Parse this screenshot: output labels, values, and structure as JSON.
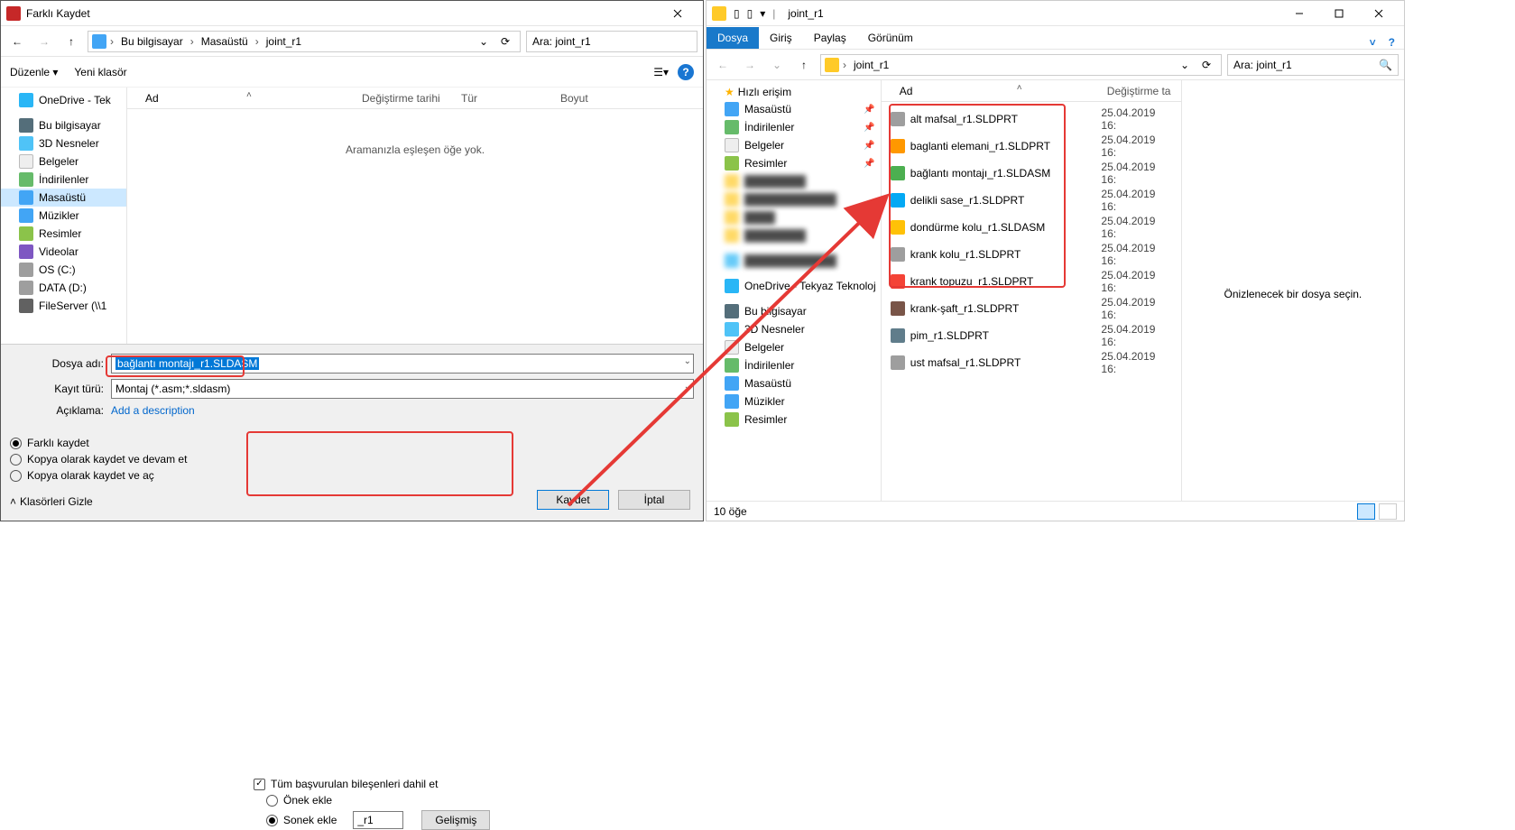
{
  "left": {
    "title": "Farklı Kaydet",
    "nav": {
      "pc": "Bu bilgisayar",
      "desk": "Masaüstü",
      "folder": "joint_r1"
    },
    "search_ph": "Ara: joint_r1",
    "toolbar": {
      "organize": "Düzenle",
      "newfolder": "Yeni klasör"
    },
    "cols": {
      "name": "Ad",
      "date": "Değiştirme tarihi",
      "type": "Tür",
      "size": "Boyut"
    },
    "empty": "Aramanızla eşleşen öğe yok.",
    "tree": {
      "onedrive": "OneDrive - Tek",
      "pc": "Bu bilgisayar",
      "objects3d": "3D Nesneler",
      "docs": "Belgeler",
      "downloads": "İndirilenler",
      "desktop": "Masaüstü",
      "music": "Müzikler",
      "pictures": "Resimler",
      "videos": "Videolar",
      "osc": "OS (C:)",
      "data": "DATA (D:)",
      "fileserver": "FileServer (\\\\1"
    },
    "lbl_filename": "Dosya adı:",
    "filename": "bağlantı montajı_r1.SLDASM",
    "lbl_filetype": "Kayıt türü:",
    "filetype": "Montaj (*.asm;*.sldasm)",
    "lbl_desc": "Açıklama:",
    "desc_link": "Add a description",
    "opt_saveas": "Farklı kaydet",
    "opt_savecopycontinue": "Kopya olarak kaydet ve devam et",
    "opt_savecopyopen": "Kopya olarak kaydet ve aç",
    "chk_includeall": "Tüm başvurulan bileşenleri dahil et",
    "opt_prefix": "Önek ekle",
    "opt_suffix": "Sonek ekle",
    "suffix_val": "_r1",
    "btn_advanced": "Gelişmiş",
    "btn_save": "Kaydet",
    "btn_cancel": "İptal",
    "hide_folders": "Klasörleri Gizle"
  },
  "right": {
    "title": "joint_r1",
    "tabs": {
      "file": "Dosya",
      "home": "Giriş",
      "share": "Paylaş",
      "view": "Görünüm"
    },
    "search_ph": "Ara: joint_r1",
    "addr_folder": "joint_r1",
    "cols": {
      "name": "Ad",
      "date": "Değiştirme ta"
    },
    "tree": {
      "quick": "Hızlı erişim",
      "desktop": "Masaüstü",
      "downloads": "İndirilenler",
      "docs": "Belgeler",
      "pictures": "Resimler",
      "onedrive": "OneDrive - Tekyaz Teknoloj",
      "pc": "Bu bilgisayar",
      "objects3d": "3D Nesneler",
      "docs2": "Belgeler",
      "downloads2": "İndirilenler",
      "desktop2": "Masaüstü",
      "music": "Müzikler",
      "pictures2": "Resimler"
    },
    "files": [
      {
        "name": "alt mafsal_r1.SLDPRT",
        "date": "25.04.2019 16:"
      },
      {
        "name": "baglanti elemani_r1.SLDPRT",
        "date": "25.04.2019 16:"
      },
      {
        "name": "bağlantı montajı_r1.SLDASM",
        "date": "25.04.2019 16:"
      },
      {
        "name": "delikli sase_r1.SLDPRT",
        "date": "25.04.2019 16:"
      },
      {
        "name": "dondürme kolu_r1.SLDASM",
        "date": "25.04.2019 16:"
      },
      {
        "name": "krank kolu_r1.SLDPRT",
        "date": "25.04.2019 16:"
      },
      {
        "name": "krank topuzu_r1.SLDPRT",
        "date": "25.04.2019 16:"
      },
      {
        "name": "krank-şaft_r1.SLDPRT",
        "date": "25.04.2019 16:"
      },
      {
        "name": "pim_r1.SLDPRT",
        "date": "25.04.2019 16:"
      },
      {
        "name": "ust mafsal_r1.SLDPRT",
        "date": "25.04.2019 16:"
      }
    ],
    "preview_msg": "Önizlenecek bir dosya seçin.",
    "status": "10 öğe"
  }
}
